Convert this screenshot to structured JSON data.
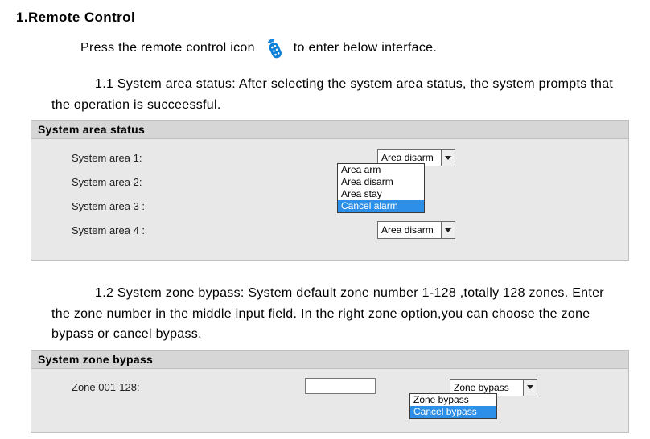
{
  "heading1": "1.Remote Control",
  "intro_before": "Press the remote control icon",
  "intro_after": "to enter below interface.",
  "section11": "1.1 System area status: After selecting the system area status, the system prompts that the operation is succeessful.",
  "status_panel": {
    "title": "System area status",
    "rows": [
      {
        "label": "System area 1:",
        "value": "Area disarm"
      },
      {
        "label": "System area 2:",
        "value": ""
      },
      {
        "label": "System area 3 :",
        "value": ""
      },
      {
        "label": "System area 4 :",
        "value": "Area disarm"
      }
    ],
    "dropdown_options": [
      "Area arm",
      "Area disarm",
      "Area stay",
      "Cancel alarm"
    ],
    "dropdown_selected": "Cancel alarm"
  },
  "section12": "1.2 System zone bypass: System default zone number 1-128 ,totally 128 zones. Enter the zone number in the middle input field. In the right zone option,you can choose the zone bypass or cancel bypass.",
  "bypass_panel": {
    "title": "System zone bypass",
    "row_label": "Zone 001-128:",
    "select_value": "Zone bypass",
    "dropdown_options": [
      "Zone bypass",
      "Cancel bypass"
    ],
    "dropdown_selected": "Cancel bypass"
  }
}
